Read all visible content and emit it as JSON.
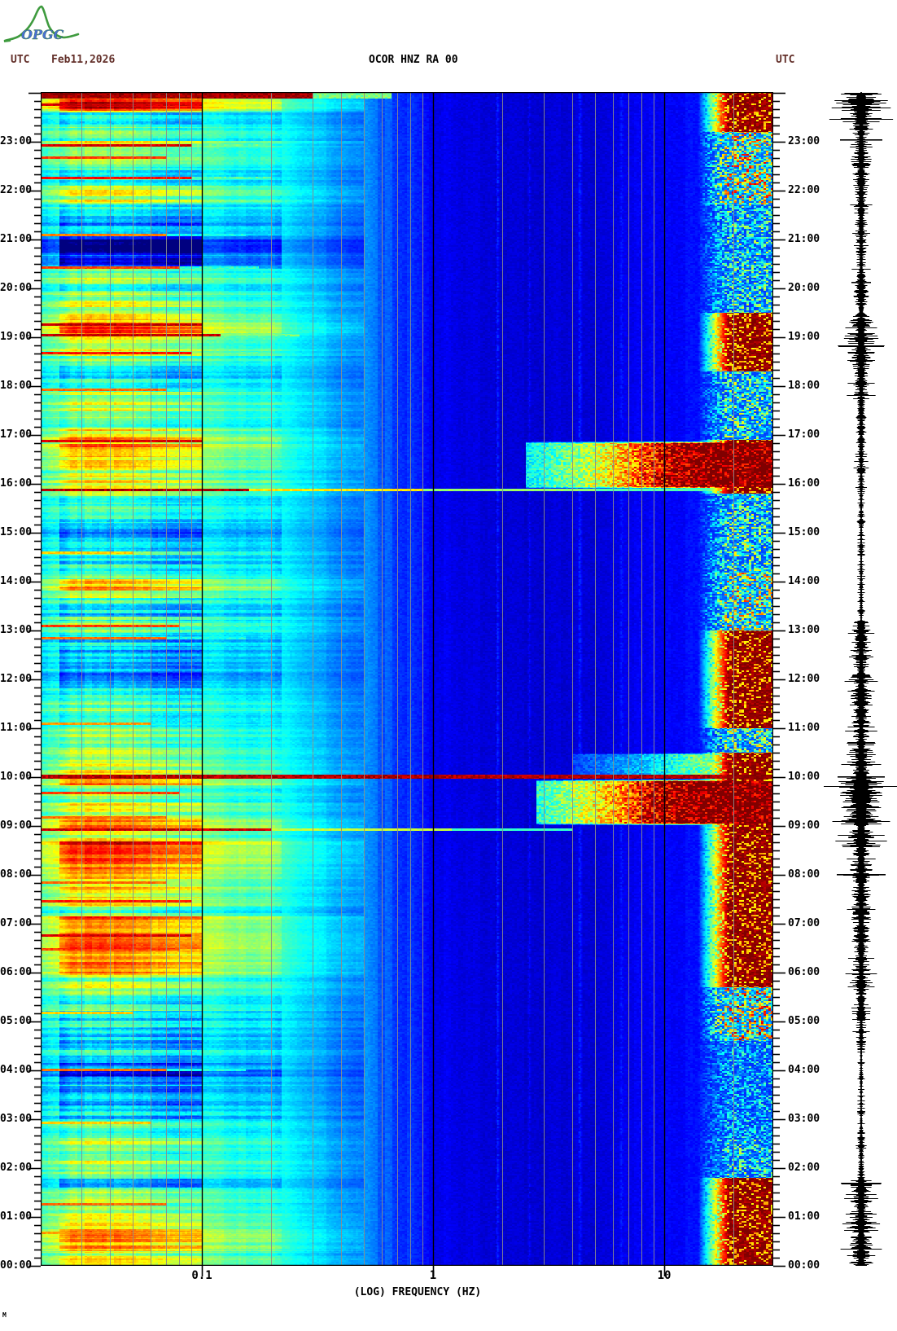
{
  "header": {
    "utc_left": "UTC",
    "date": "Feb11,2026",
    "title": "OCOR HNZ RA 00",
    "utc_right": "UTC"
  },
  "logo": {
    "text": "OPGC",
    "green": "#3f9b3f",
    "blue": "#4b6fd6"
  },
  "corner_mark": "M",
  "x_axis": {
    "title": "(LOG) FREQUENCY (HZ)",
    "ticks": [
      {
        "label": "0.1",
        "f": 0.1
      },
      {
        "label": "1",
        "f": 1
      },
      {
        "label": "10",
        "f": 10
      }
    ]
  },
  "y_axis": {
    "hours": [
      "00:00",
      "01:00",
      "02:00",
      "03:00",
      "04:00",
      "05:00",
      "06:00",
      "07:00",
      "08:00",
      "09:00",
      "10:00",
      "11:00",
      "12:00",
      "13:00",
      "14:00",
      "15:00",
      "16:00",
      "17:00",
      "18:00",
      "19:00",
      "20:00",
      "21:00",
      "22:00",
      "23:00"
    ],
    "minor_tick_minutes": 10
  },
  "chart_data": {
    "type": "heatmap",
    "subtype": "seismic-spectrogram",
    "station": "OCOR HNZ RA 00",
    "date_utc": "Feb11,2026",
    "colormap": "jet",
    "freq_axis": {
      "scale": "log",
      "min_hz": 0.02,
      "max_hz": 30,
      "labeled_ticks": [
        0.1,
        1,
        10
      ]
    },
    "time_axis": {
      "start": "00:00",
      "end": "24:00",
      "direction": "bottom-to-top",
      "hours_span": 24
    },
    "grid": {
      "gray": "#8c8c8c",
      "black_lines_hz": [
        0.1,
        1,
        10
      ]
    },
    "base_profile": [
      [
        0.02,
        0.46
      ],
      [
        0.024,
        0.5
      ],
      [
        0.027,
        0.58
      ],
      [
        0.035,
        0.6
      ],
      [
        0.05,
        0.57
      ],
      [
        0.07,
        0.53
      ],
      [
        0.1,
        0.49
      ],
      [
        0.14,
        0.45
      ],
      [
        0.2,
        0.42
      ],
      [
        0.3,
        0.34
      ],
      [
        0.5,
        0.26
      ],
      [
        0.8,
        0.16
      ],
      [
        1.0,
        0.12
      ],
      [
        1.5,
        0.09
      ],
      [
        2.5,
        0.08
      ],
      [
        5,
        0.09
      ],
      [
        8,
        0.11
      ],
      [
        12,
        0.13
      ],
      [
        15,
        0.14
      ],
      [
        20,
        0.15
      ],
      [
        30,
        0.15
      ]
    ],
    "persistent_tones_hz": [
      {
        "f": 1.9,
        "amp": 0.07
      },
      {
        "f": 2.6,
        "amp": 0.04
      },
      {
        "f": 4.3,
        "amp": 0.055
      },
      {
        "f": 6.5,
        "amp": 0.03
      }
    ],
    "microseism_band_events": [
      {
        "t": 23.93,
        "v": 1.0,
        "fmax": 0.3,
        "rows": 3
      },
      {
        "t": 23.75,
        "v": 0.95,
        "fmax": 0.1,
        "rows": 1
      },
      {
        "t": 22.92,
        "v": 0.95,
        "fmax": 0.09,
        "rows": 1
      },
      {
        "t": 22.67,
        "v": 0.85,
        "fmax": 0.07,
        "rows": 1
      },
      {
        "t": 22.25,
        "v": 0.9,
        "fmax": 0.09,
        "rows": 1
      },
      {
        "t": 21.08,
        "v": 0.78,
        "fmax": 0.07,
        "rows": 1
      },
      {
        "t": 20.42,
        "v": 0.85,
        "fmax": 0.08,
        "rows": 1
      },
      {
        "t": 19.25,
        "v": 0.97,
        "fmax": 0.1,
        "rows": 1
      },
      {
        "t": 19.03,
        "v": 0.97,
        "fmax": 0.12,
        "rows": 1
      },
      {
        "t": 18.67,
        "v": 0.9,
        "fmax": 0.09,
        "rows": 1
      },
      {
        "t": 17.92,
        "v": 0.8,
        "fmax": 0.07,
        "rows": 1
      },
      {
        "t": 16.87,
        "v": 0.95,
        "fmax": 0.1,
        "rows": 1
      },
      {
        "t": 15.87,
        "rows": 1,
        "steps": [
          [
            0.16,
            1.0
          ],
          [
            0.9,
            0.68
          ],
          [
            5,
            0.55
          ],
          [
            30,
            0.48
          ]
        ]
      },
      {
        "t": 14.58,
        "v": 0.7,
        "fmax": 0.05,
        "rows": 1
      },
      {
        "t": 13.08,
        "v": 0.85,
        "fmax": 0.08,
        "rows": 1
      },
      {
        "t": 12.83,
        "v": 0.8,
        "fmax": 0.07,
        "rows": 1
      },
      {
        "t": 11.08,
        "v": 0.75,
        "fmax": 0.06,
        "rows": 1
      },
      {
        "t": 10.0,
        "rows": 2,
        "steps": [
          [
            30,
            1.0
          ]
        ]
      },
      {
        "t": 9.67,
        "v": 0.85,
        "fmax": 0.08,
        "rows": 1
      },
      {
        "t": 9.17,
        "v": 0.8,
        "fmax": 0.07,
        "rows": 1
      },
      {
        "t": 8.92,
        "rows": 1,
        "steps": [
          [
            0.2,
            0.97
          ],
          [
            1.2,
            0.6
          ],
          [
            4,
            0.45
          ]
        ]
      },
      {
        "t": 7.83,
        "v": 0.8,
        "fmax": 0.07,
        "rows": 1
      },
      {
        "t": 7.45,
        "v": 0.88,
        "fmax": 0.09,
        "rows": 1
      },
      {
        "t": 6.75,
        "v": 0.95,
        "fmax": 0.09,
        "rows": 1
      },
      {
        "t": 6.47,
        "v": 0.85,
        "fmax": 0.08,
        "rows": 1
      },
      {
        "t": 5.17,
        "v": 0.7,
        "fmax": 0.05,
        "rows": 1
      },
      {
        "t": 4.0,
        "v": 0.8,
        "fmax": 0.07,
        "rows": 1
      },
      {
        "t": 2.92,
        "v": 0.7,
        "fmax": 0.06,
        "rows": 1
      },
      {
        "t": 1.25,
        "v": 0.8,
        "fmax": 0.07,
        "rows": 1
      },
      {
        "t": 0.67,
        "v": 0.75,
        "fmax": 0.06,
        "rows": 1
      }
    ],
    "microseism_modulation": [
      {
        "from": 20.4,
        "to": 21.0,
        "dv": -0.22
      },
      {
        "from": 3.0,
        "to": 4.3,
        "dv": -0.12
      },
      {
        "from": 14.1,
        "to": 15.2,
        "dv": -0.08
      },
      {
        "from": 0.3,
        "to": 1.6,
        "dv": 0.16
      },
      {
        "from": 5.9,
        "to": 7.6,
        "dv": 0.1
      },
      {
        "from": 8.9,
        "to": 10.0,
        "dv": 0.15
      },
      {
        "from": 18.5,
        "to": 19.3,
        "dv": 0.12
      },
      {
        "from": 22.9,
        "to": 23.3,
        "dv": 0.08
      },
      {
        "from": 23.6,
        "to": 24.0,
        "dv": 0.3
      },
      {
        "from": 12.6,
        "to": 13.2,
        "dv": 0.1
      },
      {
        "from": 0.0,
        "to": 0.2,
        "dv": 0.1
      }
    ],
    "high_freq_activity": [
      [
        0.0,
        1.8,
        0.95
      ],
      [
        1.8,
        2.6,
        0.4
      ],
      [
        2.6,
        4.6,
        0.3
      ],
      [
        4.6,
        5.7,
        0.7
      ],
      [
        5.7,
        8.7,
        1.0
      ],
      [
        8.7,
        9.0,
        0.9
      ],
      [
        9.0,
        10.0,
        1.0
      ],
      [
        10.0,
        10.5,
        0.85
      ],
      [
        10.5,
        11.0,
        0.5
      ],
      [
        11.0,
        13.0,
        0.85
      ],
      [
        13.0,
        14.2,
        0.6
      ],
      [
        14.2,
        15.8,
        0.45
      ],
      [
        15.8,
        16.9,
        1.0
      ],
      [
        16.9,
        18.3,
        0.45
      ],
      [
        18.3,
        19.5,
        0.9
      ],
      [
        19.5,
        21.7,
        0.4
      ],
      [
        21.7,
        23.2,
        0.65
      ],
      [
        23.2,
        24.0,
        0.95
      ]
    ],
    "broadband_events": [
      {
        "from": 15.88,
        "to": 16.87,
        "ramp": [
          [
            2.5,
            0.35
          ],
          [
            5,
            0.55
          ],
          [
            7,
            0.7
          ],
          [
            10,
            0.9
          ],
          [
            14,
            1.0
          ],
          [
            30,
            1.0
          ]
        ],
        "gain": 1.0
      },
      {
        "from": 9.0,
        "to": 9.95,
        "ramp": [
          [
            2.8,
            0.4
          ],
          [
            5,
            0.6
          ],
          [
            7,
            0.75
          ],
          [
            9,
            0.9
          ],
          [
            13,
            1.0
          ],
          [
            30,
            1.0
          ]
        ],
        "gain": 1.0
      },
      {
        "from": 10.0,
        "to": 10.5,
        "ramp": [
          [
            4,
            0.3
          ],
          [
            8,
            0.5
          ],
          [
            12,
            0.7
          ],
          [
            20,
            0.9
          ],
          [
            30,
            0.95
          ]
        ],
        "gain": 0.6
      }
    ],
    "seismogram_trace": {
      "envelope_segments": [
        [
          0.0,
          1.75,
          14
        ],
        [
          1.75,
          2.4,
          4
        ],
        [
          2.4,
          2.6,
          7
        ],
        [
          2.6,
          4.5,
          2.5
        ],
        [
          4.5,
          5.6,
          6
        ],
        [
          5.6,
          8.0,
          11
        ],
        [
          8.0,
          8.6,
          13
        ],
        [
          8.6,
          9.0,
          16
        ],
        [
          9.0,
          10.0,
          26
        ],
        [
          10.0,
          10.6,
          14
        ],
        [
          10.6,
          11.1,
          10
        ],
        [
          11.1,
          12.1,
          12
        ],
        [
          12.1,
          12.6,
          9
        ],
        [
          12.6,
          13.2,
          11
        ],
        [
          13.2,
          15.9,
          3
        ],
        [
          15.9,
          17.05,
          5
        ],
        [
          17.05,
          17.8,
          6
        ],
        [
          17.8,
          18.4,
          9
        ],
        [
          18.4,
          19.4,
          16
        ],
        [
          19.4,
          19.8,
          7
        ],
        [
          19.8,
          20.3,
          9
        ],
        [
          20.3,
          21.1,
          6
        ],
        [
          21.1,
          21.8,
          8
        ],
        [
          21.8,
          22.5,
          10
        ],
        [
          22.5,
          23.0,
          12
        ],
        [
          23.0,
          23.4,
          10
        ],
        [
          23.4,
          24.0,
          24
        ]
      ],
      "wide_marks": [
        {
          "t": 10.0,
          "half": 29
        },
        {
          "t": 8.0,
          "half": 30
        },
        {
          "t": 23.03,
          "half": 26
        },
        {
          "t": 20.12,
          "half": 12
        }
      ]
    }
  }
}
